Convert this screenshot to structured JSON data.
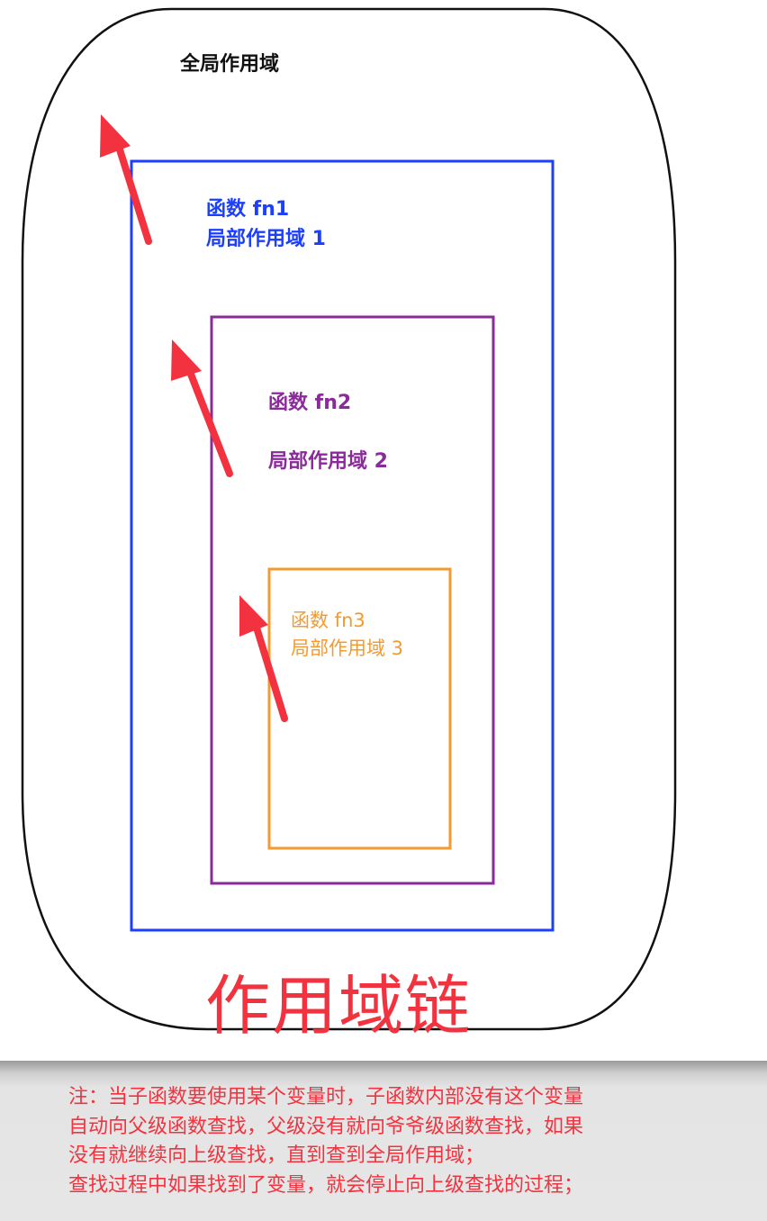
{
  "diagram": {
    "global_scope_label": "全局作用域",
    "fn1": {
      "name": "函数 fn1",
      "scope": "局部作用域 1"
    },
    "fn2": {
      "name": "函数 fn2",
      "scope": "局部作用域 2"
    },
    "fn3": {
      "name": "函数 fn3",
      "scope": "局部作用域 3"
    },
    "title": "作用域链",
    "colors": {
      "global": "#111111",
      "fn1": "#1c3fff",
      "fn2": "#8b2a9a",
      "fn3": "#f39a30",
      "arrow": "#f2333f"
    }
  },
  "note": {
    "lines": [
      "注：当子函数要使用某个变量时，子函数内部没有这个变量",
      "自动向父级函数查找，父级没有就向爷爷级函数查找，如果",
      "没有就继续向上级查找，直到查到全局作用域；",
      "查找过程中如果找到了变量，就会停止向上级查找的过程；"
    ]
  }
}
